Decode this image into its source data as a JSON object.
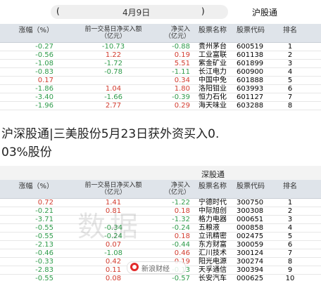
{
  "top_bar": {
    "bracket_left": "(",
    "date": "4月9日",
    "bracket_right": ")",
    "market": "沪股通"
  },
  "headline": {
    "line1": "沪深股通|三美股份5月23日获外资买入0.",
    "line2": "03%股份"
  },
  "table_top": {
    "headers": {
      "ratio": "涨幅（%）",
      "prev": "前一交易日净买入额\n（亿元）",
      "net": "净买入\n（亿元）",
      "name": "股票名称",
      "code": "股票代码",
      "rank": "排名"
    },
    "rows": [
      {
        "ratio": "-0.27",
        "prev": "-10.73",
        "net": "-0.88",
        "name": "贵州茅台",
        "code": "600519",
        "rank": "1"
      },
      {
        "ratio": "-0.56",
        "prev": "1.22",
        "net": "0.19",
        "name": "工业富联",
        "code": "601138",
        "rank": "2"
      },
      {
        "ratio": "-1.08",
        "prev": "-1.72",
        "net": "5.51",
        "name": "紫金矿业",
        "code": "601899",
        "rank": "3"
      },
      {
        "ratio": "-0.83",
        "prev": "-0.78",
        "net": "-1.11",
        "name": "长江电力",
        "code": "600900",
        "rank": "4"
      },
      {
        "ratio": "0.17",
        "prev": "",
        "net": "0.34",
        "name": "中国中免",
        "code": "601888",
        "rank": "5"
      },
      {
        "ratio": "-1.86",
        "prev": "1.04",
        "net": "1.80",
        "name": "洛阳钼业",
        "code": "603993",
        "rank": "6"
      },
      {
        "ratio": "-3.40",
        "prev": "-1.66",
        "net": "-0.39",
        "name": "恒力石化",
        "code": "601127",
        "rank": "7"
      },
      {
        "ratio": "-1.96",
        "prev": "2.77",
        "net": "0.29",
        "name": "海天味业",
        "code": "603288",
        "rank": "8"
      }
    ]
  },
  "table_bottom": {
    "subtitle": "深股通",
    "headers": {
      "ratio": "涨幅（%）",
      "prev": "前一交易日净买入额\n（亿元）",
      "net": "净买入\n（亿元）",
      "name": "股票名称",
      "code": "股票代码",
      "rank": "排名"
    },
    "rows": [
      {
        "ratio": "0.72",
        "prev": "1.41",
        "net": "-1.22",
        "name": "宁德时代",
        "code": "300750",
        "rank": "1"
      },
      {
        "ratio": "-0.21",
        "prev": "0.81",
        "net": "0.18",
        "name": "中际旭创",
        "code": "300308",
        "rank": "2"
      },
      {
        "ratio": "-3.71",
        "prev": "",
        "net": "-1.32",
        "name": "格力电器",
        "code": "000651",
        "rank": "3"
      },
      {
        "ratio": "-0.55",
        "prev": "-0.34",
        "net": "-0.24",
        "name": "五粮液",
        "code": "000858",
        "rank": "4"
      },
      {
        "ratio": "-0.55",
        "prev": "-0.24",
        "net": "0.18",
        "name": "立讯精密",
        "code": "002475",
        "rank": "5"
      },
      {
        "ratio": "-2.13",
        "prev": "0.07",
        "net": "-0.44",
        "name": "东方财富",
        "code": "300059",
        "rank": "6"
      },
      {
        "ratio": "-0.46",
        "prev": "-1.08",
        "net": "0.46",
        "name": "汇川技术",
        "code": "300124",
        "rank": "7"
      },
      {
        "ratio": "-0.33",
        "prev": "0.42",
        "net": "0.19",
        "name": "阳光电源",
        "code": "300274",
        "rank": "8"
      },
      {
        "ratio": "-2.83",
        "prev": "0.11",
        "net": "-0.13",
        "name": "天孚通信",
        "code": "300394",
        "rank": "9"
      },
      {
        "ratio": "-0.55",
        "prev": "0.08",
        "net": "-0.57",
        "name": "长安汽车",
        "code": "000625",
        "rank": "10"
      }
    ]
  },
  "footer": {
    "brand": "新浪财经"
  },
  "watermark": {
    "text": "数据"
  },
  "colors": {
    "up": "#d23b2e",
    "down": "#2e9b4a",
    "header_bg": "#dfe4ea"
  }
}
